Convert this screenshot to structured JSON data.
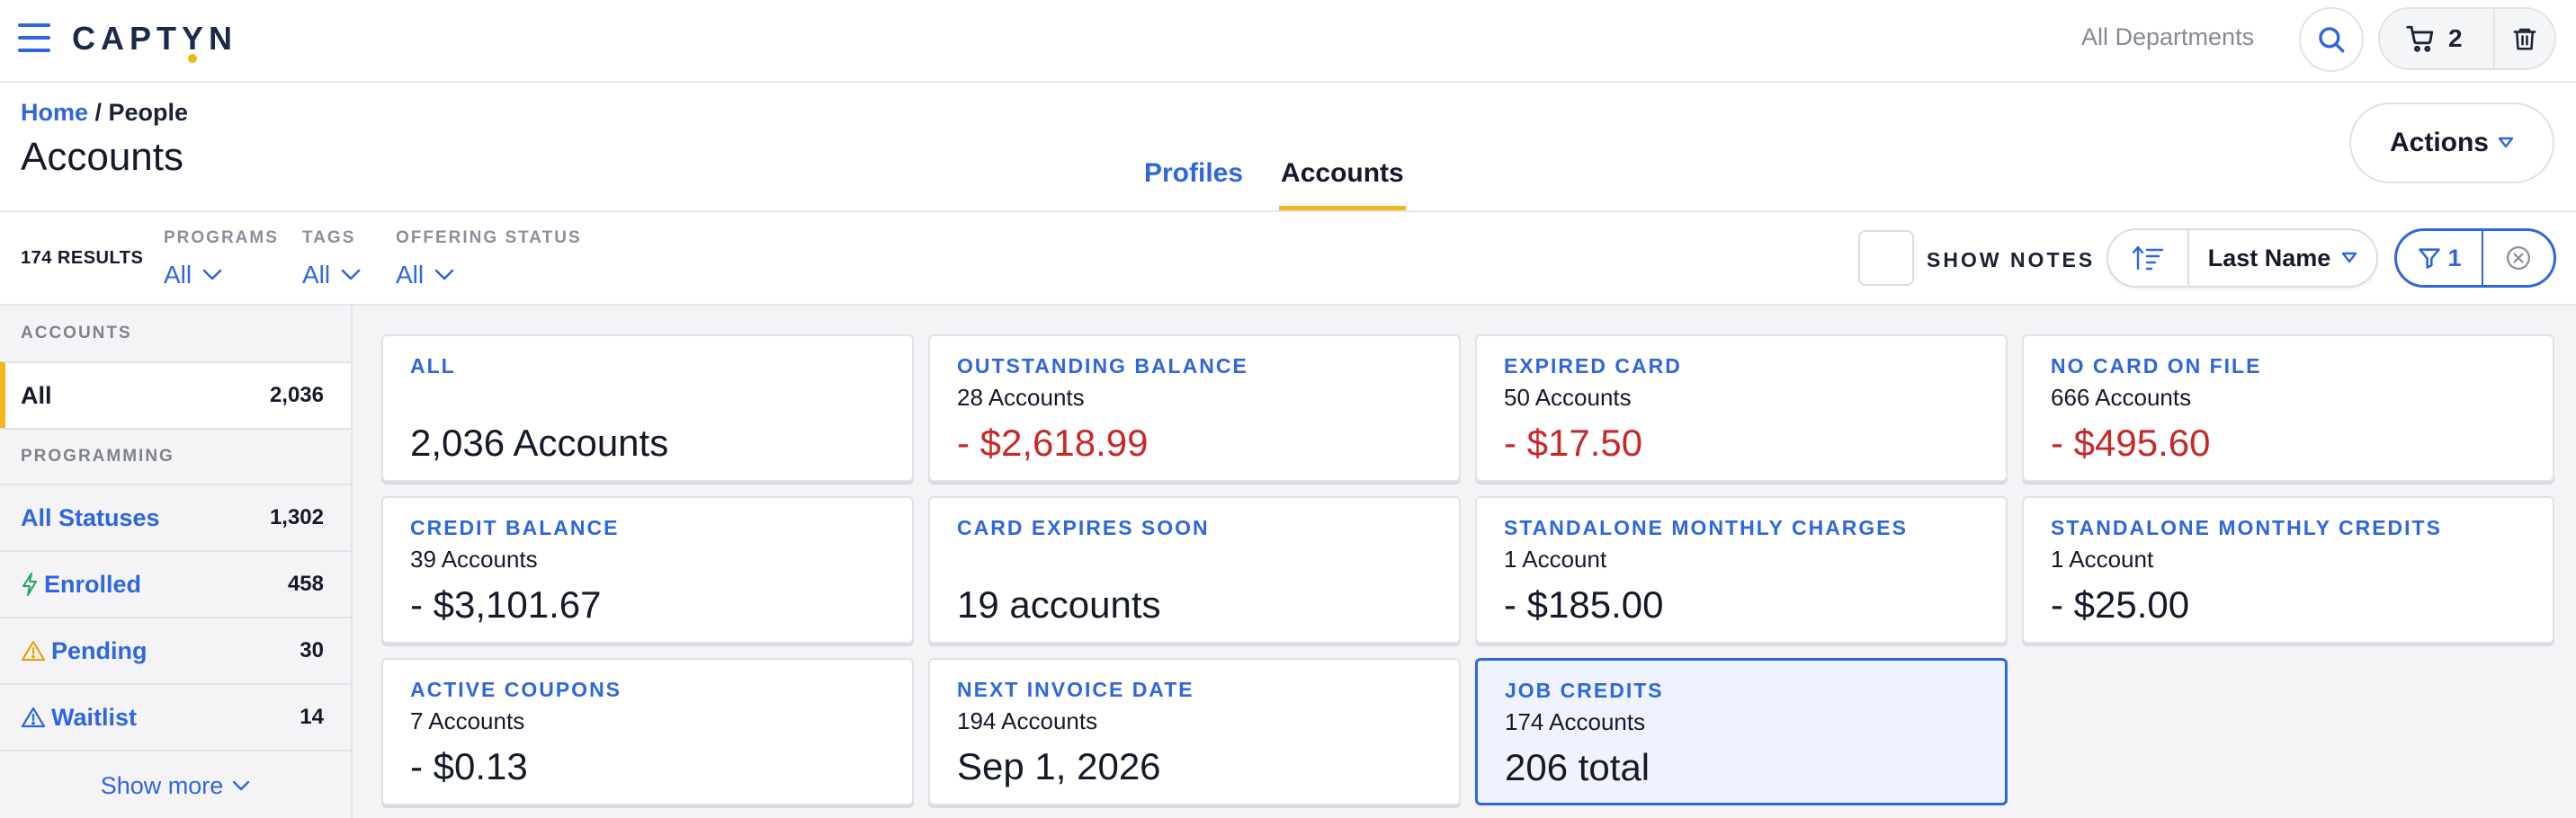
{
  "app": {
    "logo_text": "CAPTYN"
  },
  "topbar": {
    "department": "All Departments",
    "cart_count": "2"
  },
  "breadcrumb": {
    "home": "Home",
    "separator": " / ",
    "current": "People"
  },
  "page": {
    "title": "Accounts"
  },
  "tabs": [
    {
      "label": "Profiles",
      "active": false
    },
    {
      "label": "Accounts",
      "active": true
    }
  ],
  "actions": {
    "label": "Actions"
  },
  "filters": {
    "results": "174 RESULTS",
    "programs": {
      "label": "PROGRAMS",
      "value": "All"
    },
    "tags": {
      "label": "TAGS",
      "value": "All"
    },
    "offering_status": {
      "label": "OFFERING STATUS",
      "value": "All"
    },
    "show_notes": "SHOW NOTES",
    "sort": "Last Name",
    "filter_count": "1"
  },
  "sidebar": {
    "accounts_header": "ACCOUNTS",
    "all": {
      "label": "All",
      "count": "2,036"
    },
    "programming_header": "PROGRAMMING",
    "items": [
      {
        "label": "All Statuses",
        "count": "1,302",
        "icon": ""
      },
      {
        "label": "Enrolled",
        "count": "458",
        "icon": "lightning-icon"
      },
      {
        "label": "Pending",
        "count": "30",
        "icon": "warning-icon"
      },
      {
        "label": "Waitlist",
        "count": "14",
        "icon": "waitlist-icon"
      }
    ],
    "show_more": "Show more"
  },
  "cards": [
    {
      "title": "ALL",
      "sub": "",
      "value": "2,036 Accounts",
      "negative": false
    },
    {
      "title": "OUTSTANDING BALANCE",
      "sub": "28 Accounts",
      "value": "- $2,618.99",
      "negative": true
    },
    {
      "title": "EXPIRED CARD",
      "sub": "50 Accounts",
      "value": "- $17.50",
      "negative": true
    },
    {
      "title": "NO CARD ON FILE",
      "sub": "666 Accounts",
      "value": "- $495.60",
      "negative": true
    },
    {
      "title": "CREDIT BALANCE",
      "sub": "39 Accounts",
      "value": "- $3,101.67",
      "negative": false
    },
    {
      "title": "CARD EXPIRES SOON",
      "sub": "",
      "value": "19 accounts",
      "negative": false
    },
    {
      "title": "STANDALONE MONTHLY CHARGES",
      "sub": "1 Account",
      "value": "- $185.00",
      "negative": false
    },
    {
      "title": "STANDALONE MONTHLY CREDITS",
      "sub": "1 Account",
      "value": "- $25.00",
      "negative": false
    },
    {
      "title": "ACTIVE COUPONS",
      "sub": "7 Accounts",
      "value": "- $0.13",
      "negative": false
    },
    {
      "title": "NEXT INVOICE DATE",
      "sub": "194 Accounts",
      "value": "Sep 1, 2026",
      "negative": false
    },
    {
      "title": "JOB CREDITS",
      "sub": "174 Accounts",
      "value": "206 total",
      "negative": false,
      "selected": true
    }
  ],
  "colors": {
    "accent": "#2f66e0",
    "highlight": "#f2b71c",
    "negative": "#c8282a"
  }
}
